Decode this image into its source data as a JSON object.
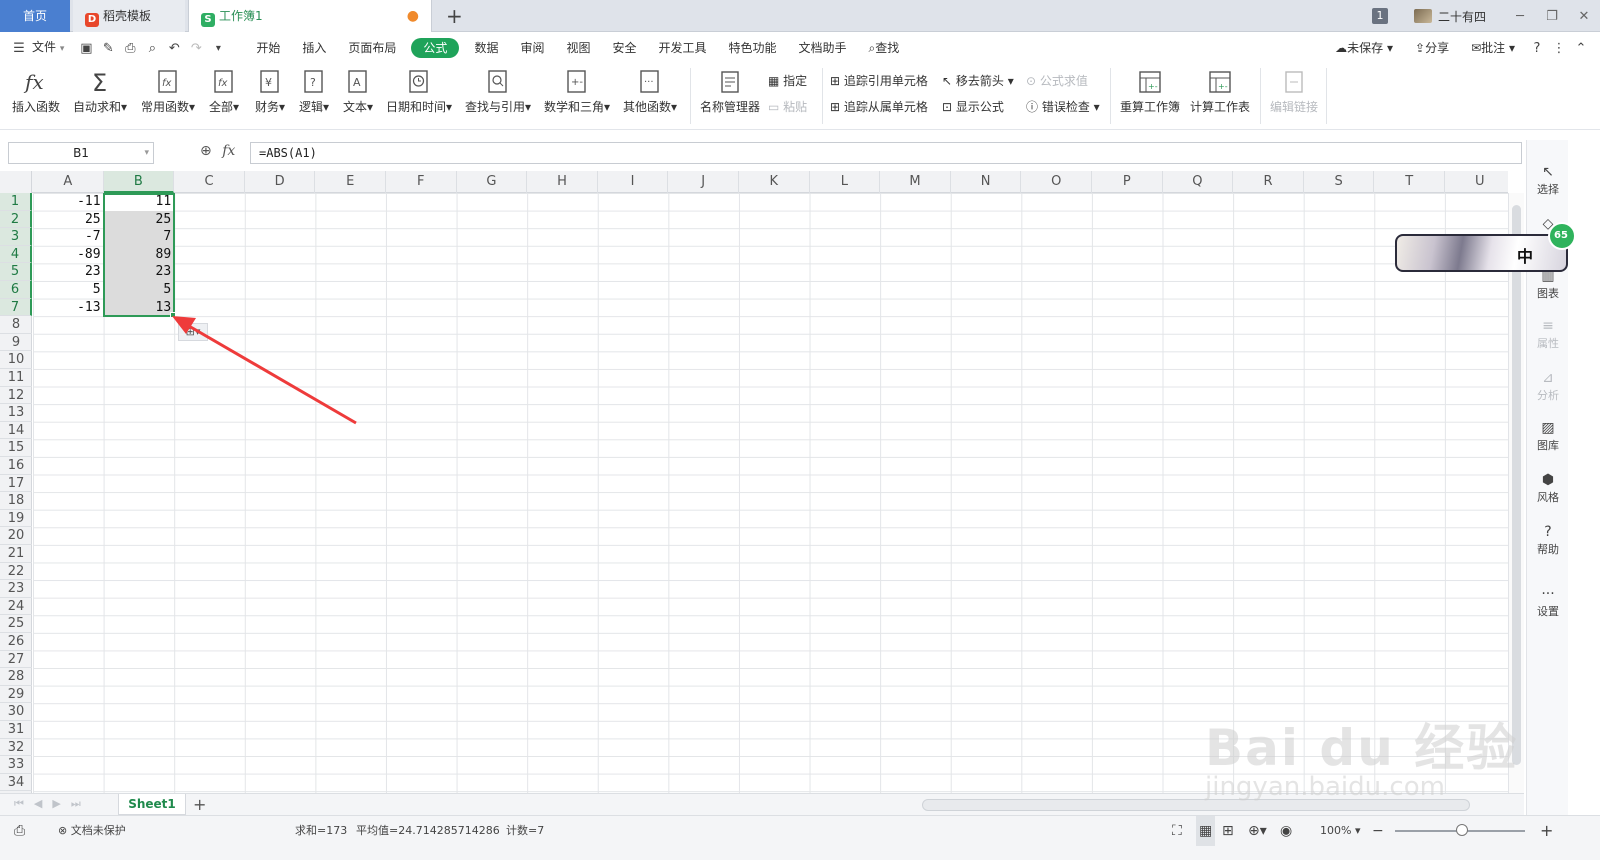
{
  "tabs": {
    "home": "首页",
    "daoke": "稻壳模板",
    "workbook": "工作簿1",
    "add": "+"
  },
  "titlebar": {
    "window_count": "1",
    "user_name": "二十有四"
  },
  "menu": {
    "file": "文件",
    "items": [
      "开始",
      "插入",
      "页面布局",
      "公式",
      "数据",
      "审阅",
      "视图",
      "安全",
      "开发工具",
      "特色功能",
      "文档助手"
    ],
    "active": "公式",
    "search": "查找",
    "unsaved": "未保存",
    "share": "分享",
    "comment": "批注"
  },
  "ribbon": {
    "insert_function": "插入函数",
    "autosum": "自动求和",
    "common_functions": "常用函数",
    "all": "全部",
    "finance": "财务",
    "logic": "逻辑",
    "text": "文本",
    "datetime": "日期和时间",
    "lookup": "查找与引用",
    "math": "数学和三角",
    "other": "其他函数",
    "name_manager": "名称管理器",
    "define": "指定",
    "paste": "粘贴",
    "trace_precedents": "追踪引用单元格",
    "trace_dependents": "追踪从属单元格",
    "remove_arrows": "移去箭头",
    "show_formulas": "显示公式",
    "evaluate": "公式求值",
    "error_check": "错误检查",
    "recalc_workbook": "重算工作簿",
    "calc_sheet": "计算工作表",
    "edit_links": "编辑链接"
  },
  "formula_bar": {
    "name_box": "B1",
    "fx": "fx",
    "formula": "=ABS(A1)"
  },
  "grid": {
    "columns": [
      "A",
      "B",
      "C",
      "D",
      "E",
      "F",
      "G",
      "H",
      "I",
      "J",
      "K",
      "L",
      "M",
      "N",
      "O",
      "P",
      "Q",
      "R",
      "S",
      "T",
      "U"
    ],
    "selected_column": "B",
    "rows": [
      "1",
      "2",
      "3",
      "4",
      "5",
      "6",
      "7",
      "8",
      "9",
      "10",
      "11",
      "12",
      "13",
      "14",
      "15",
      "16",
      "17",
      "18",
      "19",
      "20",
      "21",
      "22",
      "23",
      "24",
      "25",
      "26",
      "27",
      "28",
      "29",
      "30",
      "31",
      "32",
      "33",
      "34"
    ],
    "col_a": [
      "-11",
      "25",
      "-7",
      "-89",
      "23",
      "5",
      "-13"
    ],
    "col_b": [
      "11",
      "25",
      "7",
      "89",
      "23",
      "5",
      "13"
    ]
  },
  "sheet": {
    "active_tab": "Sheet1",
    "add": "+"
  },
  "side_panel": {
    "select": "选择",
    "chart": "图表",
    "property": "属性",
    "analysis": "分析",
    "gallery": "图库",
    "style": "风格",
    "help": "帮助",
    "settings": "设置"
  },
  "floating": {
    "char": "中",
    "counter": "65"
  },
  "statusbar": {
    "protect": "文档未保护",
    "sum": "求和=173",
    "average": "平均值=24.714285714286",
    "count": "计数=7",
    "zoom": "100%"
  },
  "watermark": {
    "brand": "Bai du 经验",
    "url": "jingyan.baidu.com"
  },
  "colors": {
    "accent": "#1fa35a",
    "tab_home": "#4a7fd0",
    "selection": "#2e9a57",
    "arrow": "#ee3b3b"
  }
}
